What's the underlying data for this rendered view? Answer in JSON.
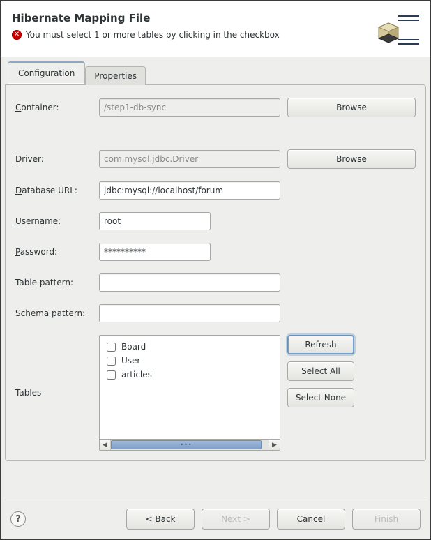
{
  "banner": {
    "title": "Hibernate Mapping File",
    "error_message": "You must select 1 or more tables by clicking in the checkbox"
  },
  "tabs": {
    "configuration": "Configuration",
    "properties": "Properties"
  },
  "form": {
    "container_label": "Container:",
    "container_value": "/step1-db-sync",
    "driver_label": "Driver:",
    "driver_value": "com.mysql.jdbc.Driver",
    "dburl_label": "Database URL:",
    "dburl_value": "jdbc:mysql://localhost/forum",
    "username_label": "Username:",
    "username_value": "root",
    "password_label": "Password:",
    "password_value": "**********",
    "table_pattern_label": "Table pattern:",
    "table_pattern_value": "",
    "schema_pattern_label": "Schema pattern:",
    "schema_pattern_value": "",
    "tables_label": "Tables",
    "browse_label": "Browse",
    "refresh_label": "Refresh",
    "select_all_label": "Select All",
    "select_none_label": "Select None"
  },
  "tables": {
    "items": [
      {
        "label": "Board",
        "checked": false
      },
      {
        "label": "User",
        "checked": false
      },
      {
        "label": "articles",
        "checked": false
      }
    ]
  },
  "footer": {
    "back": "< Back",
    "next": "Next >",
    "cancel": "Cancel",
    "finish": "Finish"
  },
  "icons": {
    "error": "error-icon",
    "help": "help-icon",
    "logo": "hibernate-logo"
  },
  "colors": {
    "accent": "#729fcf",
    "error": "#cc0000",
    "panel_bg": "#eeeeec"
  }
}
